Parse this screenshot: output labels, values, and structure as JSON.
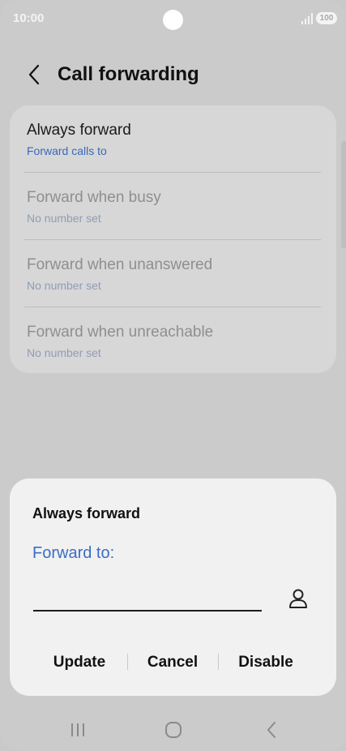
{
  "status_bar": {
    "time": "10:00",
    "battery": "100",
    "icons": [
      "signal-icon",
      "battery-icon",
      "camera-cutout"
    ]
  },
  "header": {
    "back_icon": "chevron-left-icon",
    "title": "Call forwarding"
  },
  "settings": {
    "items": [
      {
        "title": "Always forward",
        "subtitle": "Forward calls to",
        "state": "active"
      },
      {
        "title": "Forward when busy",
        "subtitle": "No number set",
        "state": "disabled"
      },
      {
        "title": "Forward when unanswered",
        "subtitle": "No number set",
        "state": "disabled"
      },
      {
        "title": "Forward when unreachable",
        "subtitle": "No number set",
        "state": "disabled"
      }
    ]
  },
  "dialog": {
    "title": "Always forward",
    "label": "Forward to:",
    "input_value": "",
    "contact_icon": "person-icon",
    "actions": {
      "update": "Update",
      "cancel": "Cancel",
      "disable": "Disable"
    }
  },
  "nav_bar": {
    "icons": [
      "recent-apps-icon",
      "home-icon",
      "back-icon"
    ]
  },
  "colors": {
    "accent": "#3c6dc4",
    "background": "#cbcbcb",
    "card": "#d7d7d7",
    "dialog": "#f1f1f1"
  }
}
